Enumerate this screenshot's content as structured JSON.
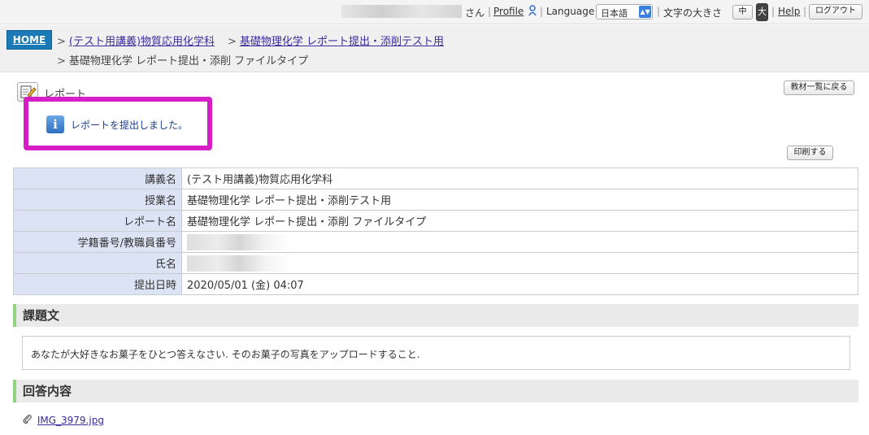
{
  "topbar": {
    "san": "さん",
    "profile": "Profile",
    "language_label": "Language",
    "language_value": "日本語",
    "font_size_label": "文字の大きさ",
    "font_mid": "中",
    "font_large": "大",
    "help": "Help",
    "logout": "ログアウト",
    "sep": "|"
  },
  "breadcrumb": {
    "home": "HOME",
    "course": "(テスト用講義)物質応用化学科",
    "class": "基礎物理化学 レポート提出・添削テスト用",
    "current": "基礎物理化学 レポート提出・添削 ファイルタイプ",
    "gt": ">"
  },
  "report": {
    "title": "レポート",
    "back_button": "教材一覧に戻る",
    "print_button": "印刷する",
    "notice": "レポートを提出しました。",
    "notice_icon": "i"
  },
  "info": {
    "rows": [
      {
        "label": "講義名",
        "value": "(テスト用講義)物質応用化学科"
      },
      {
        "label": "授業名",
        "value": "基礎物理化学 レポート提出・添削テスト用"
      },
      {
        "label": "レポート名",
        "value": "基礎物理化学 レポート提出・添削 ファイルタイプ"
      },
      {
        "label": "学籍番号/教職員番号",
        "value": ""
      },
      {
        "label": "氏名",
        "value": ""
      },
      {
        "label": "提出日時",
        "value": "2020/05/01 (金) 04:07"
      }
    ]
  },
  "task": {
    "heading": "課題文",
    "text": "あなたが大好きなお菓子をひとつ答えなさい. そのお菓子の写真をアップロードすること."
  },
  "answer": {
    "heading": "回答内容",
    "file": "IMG_3979.jpg"
  },
  "icons": {
    "profile": "person-icon",
    "report": "report-pencil-icon",
    "attach": "paperclip-icon"
  }
}
